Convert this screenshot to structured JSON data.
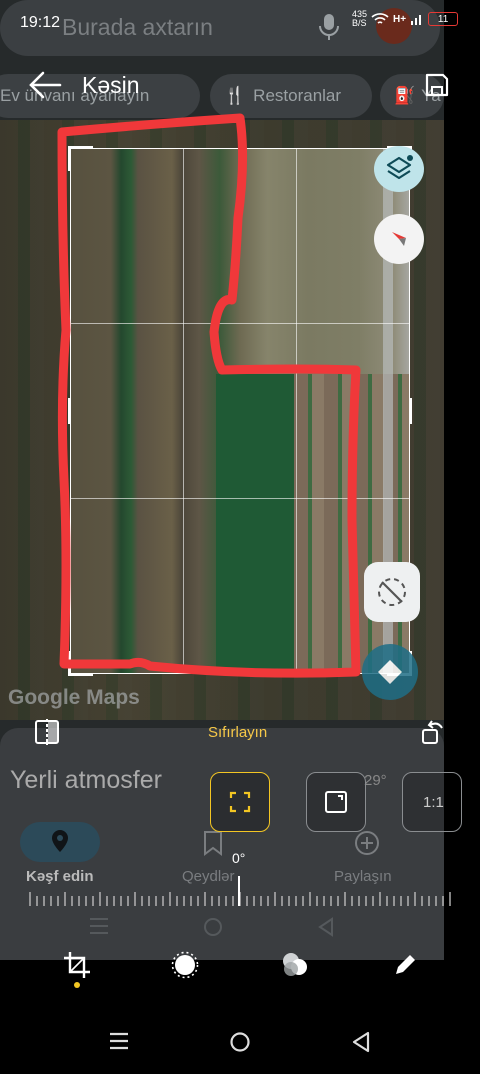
{
  "status_bar": {
    "time": "19:12",
    "net_speed": "435",
    "net_unit": "B/S",
    "network": "H+",
    "battery": "11"
  },
  "maps": {
    "search_placeholder": "Burada axtarın",
    "chips": [
      {
        "label": "Ev ünvanı ayarlayın"
      },
      {
        "label": "Restoranlar"
      },
      {
        "label": "Ya"
      }
    ],
    "logo_text": "Google Maps",
    "sheet_title": "Yerli atmosfer",
    "temperature": "29°",
    "bottom_nav": [
      {
        "label": "Kəşf edin"
      },
      {
        "label": "Qeydlər"
      },
      {
        "label": "Paylaşın"
      }
    ]
  },
  "editor": {
    "title": "Kəsin",
    "reset_label": "Sıfırlayın",
    "angle": "0°",
    "aspect_ratio_label": "1:1",
    "accent_color": "#f3c623",
    "annotation_color": "#f0383a",
    "tools": [
      {
        "icon": "crop-icon",
        "active": true
      },
      {
        "icon": "brightness-icon",
        "active": false
      },
      {
        "icon": "filters-icon",
        "active": false
      },
      {
        "icon": "pen-icon",
        "active": false
      }
    ]
  }
}
